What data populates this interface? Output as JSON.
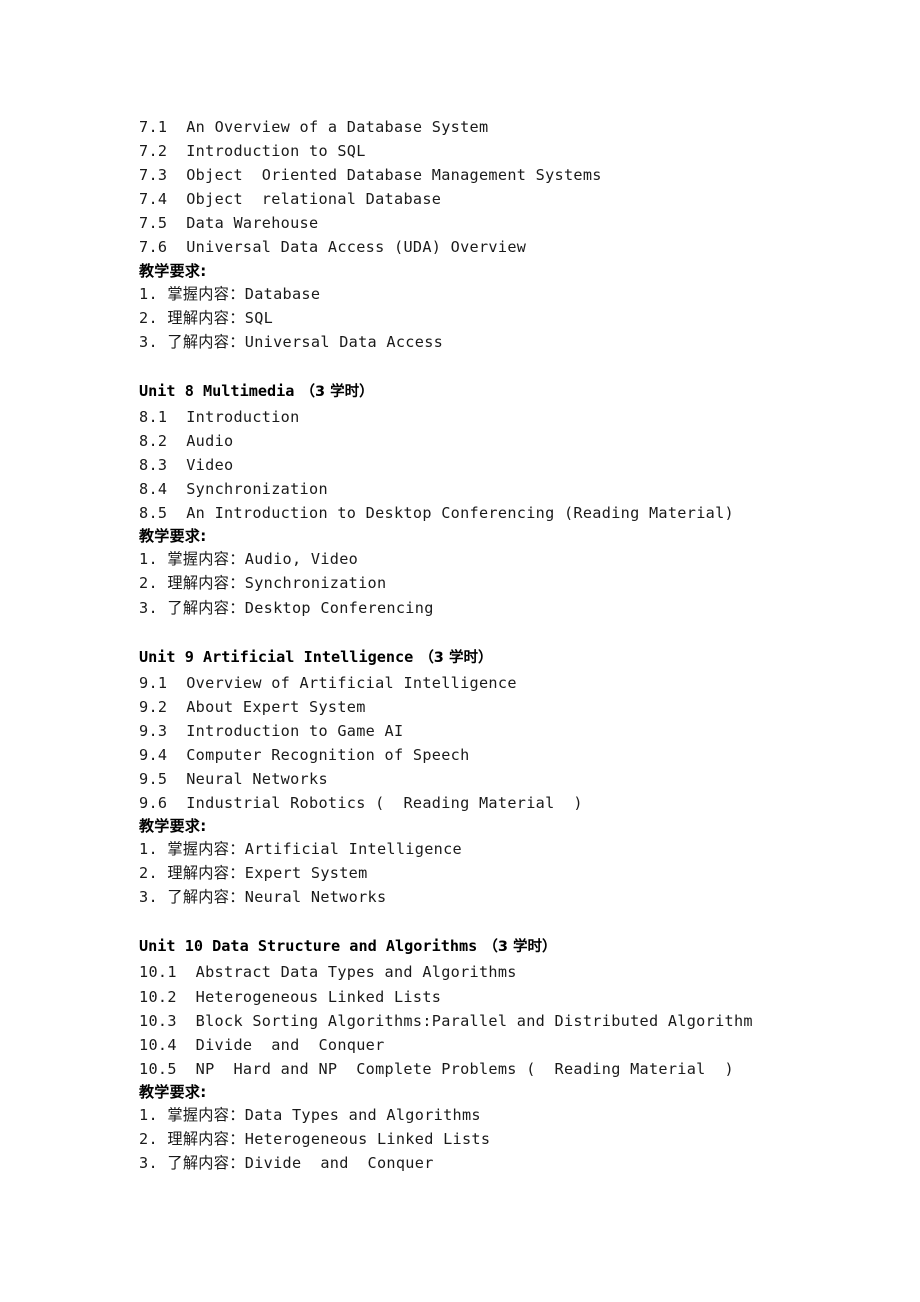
{
  "unit7": {
    "sections": [
      {
        "num": "7.1",
        "title": "An Overview of a Database System"
      },
      {
        "num": "7.2",
        "title": "Introduction to SQL"
      },
      {
        "num": "7.3",
        "title": "Object  Oriented Database Management Systems"
      },
      {
        "num": "7.4",
        "title": "Object  relational Database"
      },
      {
        "num": "7.5",
        "title": "Data Warehouse"
      },
      {
        "num": "7.6",
        "title": "Universal Data Access (UDA) Overview"
      }
    ],
    "requirements_heading": "教学要求:",
    "requirements": [
      "1. 掌握内容：Database",
      "2. 理解内容：SQL",
      "3. 了解内容：Universal Data Access"
    ]
  },
  "unit8": {
    "title": "Unit 8  Multimedia",
    "hours": "（3 学时）",
    "sections": [
      {
        "num": "8.1",
        "title": "Introduction"
      },
      {
        "num": "8.2",
        "title": "Audio"
      },
      {
        "num": "8.3",
        "title": "Video"
      },
      {
        "num": "8.4",
        "title": "Synchronization"
      },
      {
        "num": "8.5",
        "title": "An Introduction to Desktop Conferencing (Reading Material)"
      }
    ],
    "requirements_heading": "教学要求:",
    "requirements": [
      "1. 掌握内容：Audio, Video",
      "2. 理解内容：Synchronization",
      "3. 了解内容：Desktop Conferencing"
    ]
  },
  "unit9": {
    "title": "Unit 9  Artificial Intelligence",
    "hours": "（3 学时）",
    "sections": [
      {
        "num": "9.1",
        "title": "Overview of Artificial Intelligence"
      },
      {
        "num": "9.2",
        "title": "About Expert System"
      },
      {
        "num": "9.3",
        "title": "Introduction to Game AI"
      },
      {
        "num": "9.4",
        "title": "Computer Recognition of Speech"
      },
      {
        "num": "9.5",
        "title": "Neural Networks"
      },
      {
        "num": "9.6",
        "title": "Industrial Robotics (  Reading Material  )"
      }
    ],
    "requirements_heading": "教学要求:",
    "requirements": [
      "1. 掌握内容：Artificial Intelligence",
      "2. 理解内容：Expert System",
      "3. 了解内容：Neural Networks"
    ]
  },
  "unit10": {
    "title": "Unit 10  Data Structure and Algorithms",
    "hours": "（3 学时）",
    "sections": [
      {
        "num": "10.1",
        "title": "Abstract Data Types and Algorithms"
      },
      {
        "num": "10.2",
        "title": "Heterogeneous Linked Lists"
      },
      {
        "num": "10.3",
        "title": "Block Sorting Algorithms:Parallel and Distributed Algorithm"
      },
      {
        "num": "10.4",
        "title": "Divide  and  Conquer"
      },
      {
        "num": "10.5",
        "title": "NP  Hard and NP  Complete Problems (  Reading Material  )"
      }
    ],
    "requirements_heading": "教学要求:",
    "requirements": [
      "1. 掌握内容：Data Types and Algorithms",
      "2. 理解内容：Heterogeneous Linked Lists",
      "3. 了解内容：Divide  and  Conquer"
    ]
  }
}
